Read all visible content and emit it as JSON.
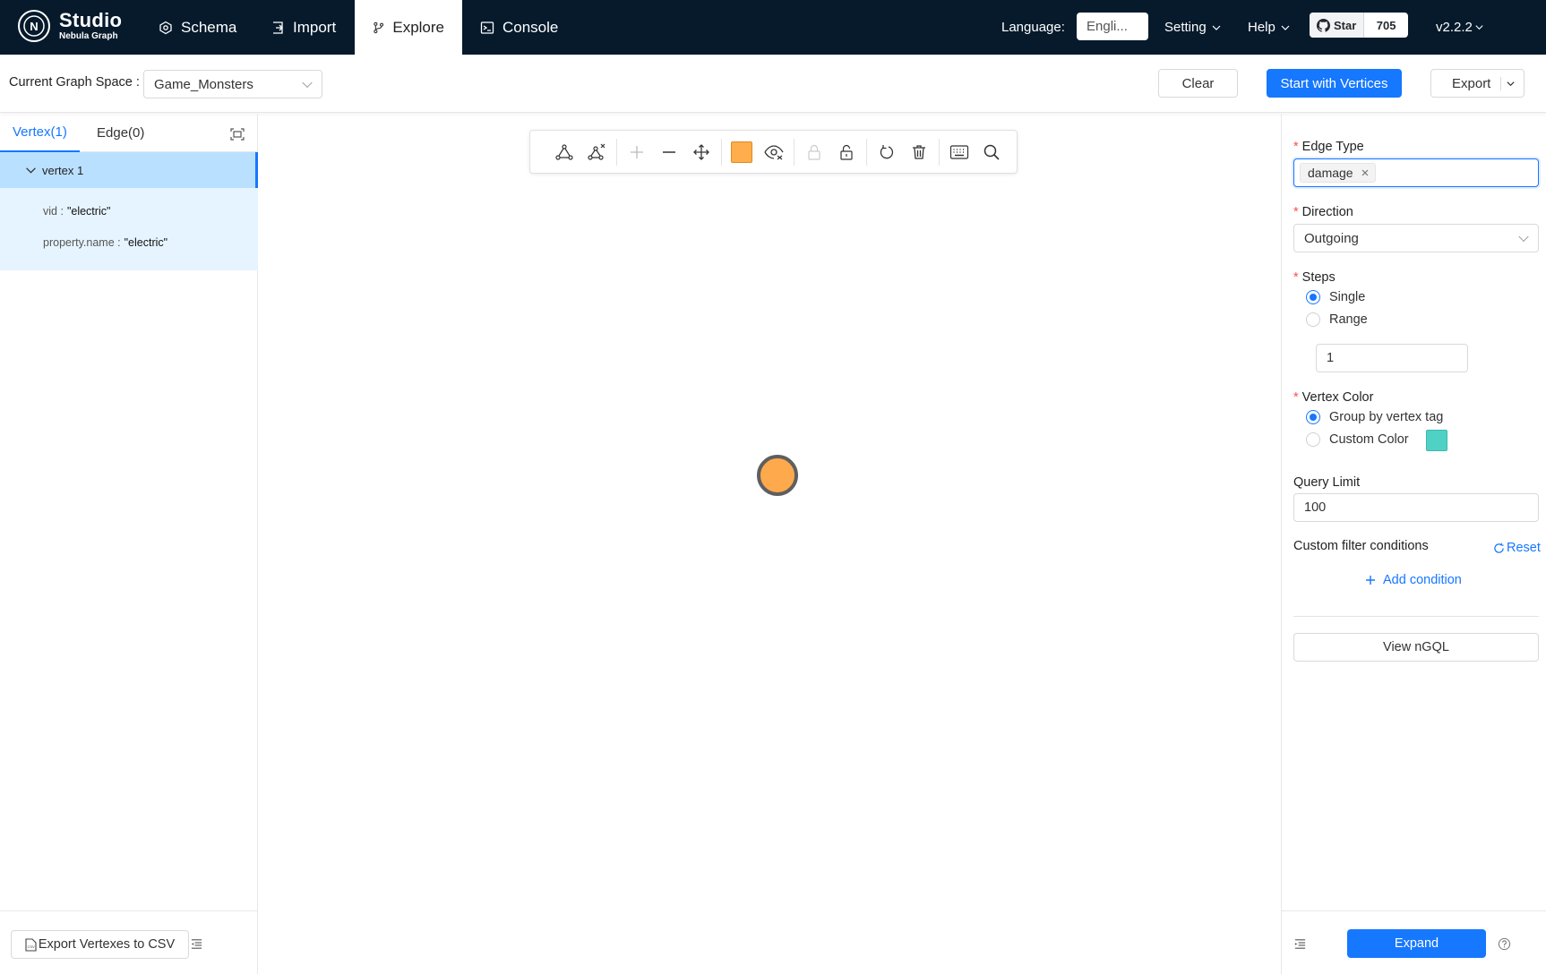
{
  "header": {
    "logo_title": "Studio",
    "logo_subtitle": "Nebula Graph",
    "nav": {
      "schema": "Schema",
      "import": "Import",
      "explore": "Explore",
      "console": "Console"
    },
    "language_label": "Language:",
    "language_value": "Engli...",
    "setting": "Setting",
    "help": "Help",
    "github_star": "Star",
    "github_count": "705",
    "version": "v2.2.2"
  },
  "subbar": {
    "space_label": "Current Graph Space :",
    "space_value": "Game_Monsters",
    "clear": "Clear",
    "start": "Start with Vertices",
    "export": "Export"
  },
  "left": {
    "tab_vertex": "Vertex(1)",
    "tab_edge": "Edge(0)",
    "vertex_title": "vertex 1",
    "props": [
      {
        "key": "vid :",
        "value": "\"electric\""
      },
      {
        "key": "property.name :",
        "value": "\"electric\""
      }
    ],
    "export_csv": "Export Vertexes to CSV"
  },
  "canvas": {
    "node_color": "#ffa94d",
    "toolbar_color_swatch": "#ffad4d"
  },
  "right": {
    "edge_type_label": "Edge Type",
    "edge_type_tag": "damage",
    "direction_label": "Direction",
    "direction_value": "Outgoing",
    "steps_label": "Steps",
    "step_single": "Single",
    "step_range": "Range",
    "steps_value": "1",
    "vertex_color_label": "Vertex Color",
    "color_group": "Group by vertex tag",
    "color_custom": "Custom Color",
    "custom_color": "#4fd1c5",
    "query_limit_label": "Query Limit",
    "query_limit_value": "100",
    "filter_label": "Custom filter conditions",
    "reset": "Reset",
    "add_condition": "Add condition",
    "view_ngql": "View nGQL",
    "expand": "Expand"
  }
}
